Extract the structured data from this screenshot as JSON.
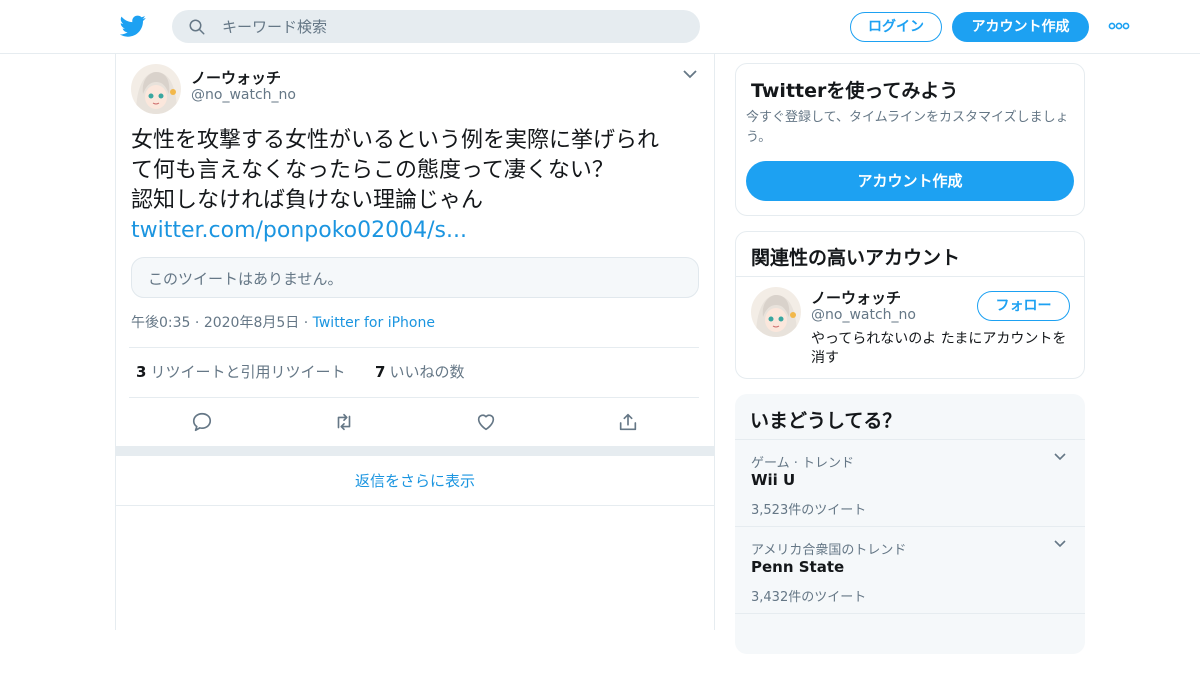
{
  "header": {
    "search_placeholder": "キーワード検索",
    "login_label": "ログイン",
    "signup_label": "アカウント作成",
    "brand_color": "#1da1f2"
  },
  "tweet": {
    "author_name": "ノーウォッチ",
    "author_handle": "@no_watch_no",
    "text_line1": "女性を攻撃する女性がいるという例を実際に挙げられ",
    "text_line2": "て何も言えなくなったらこの態度って凄くない？",
    "text_line3": "認知しなければ負けない理論じゃん",
    "link": "twitter.com/ponpoko02004/s...",
    "quote_unavailable": "このツイートはありません。",
    "time": "午後0:35",
    "date": "2020年8月5日",
    "source": "Twitter for iPhone",
    "retweet_count": "3",
    "retweet_label": "リツイートと引用リツイート",
    "like_count": "7",
    "like_label": "いいねの数",
    "show_more_replies": "返信をさらに表示"
  },
  "sidebar": {
    "signup_card": {
      "title": "Twitterを使ってみよう",
      "description": "今すぐ登録して、タイムラインをカスタマイズしましょう。",
      "button": "アカウント作成"
    },
    "related_card": {
      "title": "関連性の高いアカウント",
      "name": "ノーウォッチ",
      "handle": "@no_watch_no",
      "bio": "やってられないのよ たまにアカウントを消す",
      "follow_label": "フォロー"
    },
    "trends_card": {
      "title": "いまどうしてる？",
      "items": [
        {
          "category": "ゲーム · トレンド",
          "name": "Wii U",
          "count": "3,523件のツイート"
        },
        {
          "category": "アメリカ合衆国のトレンド",
          "name": "Penn State",
          "count": "3,432件のツイート"
        }
      ]
    }
  }
}
